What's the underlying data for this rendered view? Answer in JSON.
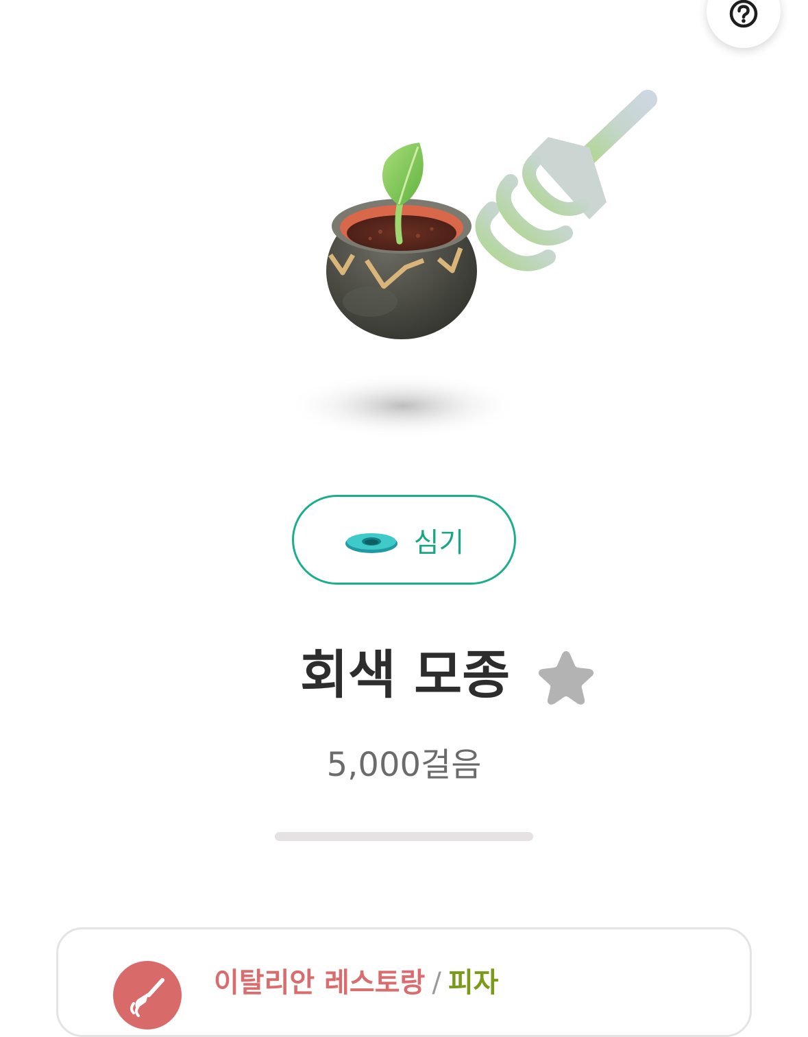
{
  "header": {
    "help_icon": "question-circle-icon"
  },
  "hero": {
    "illustration": "seedling-in-gray-pot",
    "decor_icon": "fork-icon"
  },
  "plant_button": {
    "label": "심기",
    "icon": "saucer-icon",
    "accent_color": "#1bae8c"
  },
  "item": {
    "name": "회색 모종",
    "favorite_icon": "star-icon",
    "favorited": false,
    "steps_label": "5,000걸음",
    "progress": 0
  },
  "card": {
    "avatar_icon": "broom-icon",
    "place": "이탈리안 레스토랑",
    "separator": "/",
    "food": "피자",
    "place_color": "#d96d6d",
    "food_color": "#7a9a1a"
  }
}
